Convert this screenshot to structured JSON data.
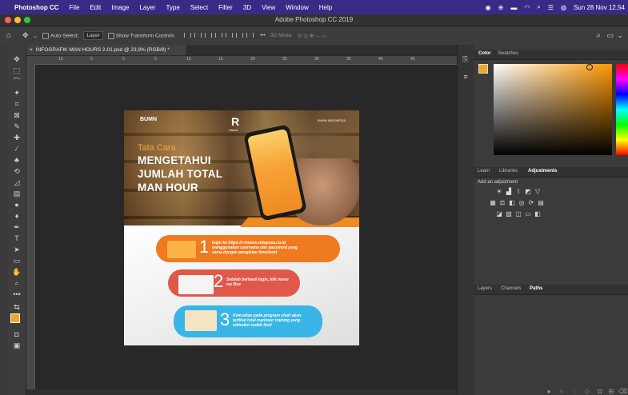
{
  "menubar": {
    "app": "Photoshop CC",
    "items": [
      "File",
      "Edit",
      "Image",
      "Layer",
      "Type",
      "Select",
      "Filter",
      "3D",
      "View",
      "Window",
      "Help"
    ],
    "datetime": "Sun 28 Nov 12.54"
  },
  "window": {
    "title": "Adobe Photoshop CC 2019"
  },
  "options": {
    "auto_select_label": "Auto-Select:",
    "auto_select_value": "Layer",
    "transform_label": "Show Transform Controls",
    "mode_3d": "3D Mode:",
    "more": "•••"
  },
  "document": {
    "tab_title": "INFOGRAFIK MAN HOURS 2-01.psd @ 23,9% (RGB/8) *",
    "ruler_marks": [
      "10",
      "5",
      "0",
      "5",
      "10",
      "15",
      "20",
      "25",
      "30",
      "35",
      "40",
      "45"
    ]
  },
  "artwork": {
    "logo_left": "BUMN",
    "logo_center": "rekind",
    "logo_right": "BUMN INDONESIA",
    "title_small": "Tata Cara",
    "title_lines": [
      "MENGETAHUI",
      "JUMLAH TOTAL",
      "MAN HOUR"
    ],
    "steps": [
      {
        "num": "1",
        "text": "login ke https://r-knows.rekayasa.co.id menggunakan username dan password yang sama dengan pengisian timesheet"
      },
      {
        "num": "2",
        "text": "Setelah berhasil login, klik menu my Box"
      },
      {
        "num": "3",
        "text": "Kemudian pada program chart akan terlihat total manhour training yang rekindist sudah ikuti"
      }
    ]
  },
  "panels": {
    "color_tabs": [
      "Color",
      "Swatches"
    ],
    "mid_tabs": [
      "Learn",
      "Libraries",
      "Adjustments"
    ],
    "add_adjustment": "Add an adjustment",
    "bottom_tabs": [
      "Layers",
      "Channels",
      "Paths"
    ]
  },
  "colors": {
    "foreground": "#f5a623",
    "background": "#ffffff",
    "step1": "#f07a1f",
    "step2": "#e0584a",
    "step3": "#39b6e6"
  }
}
